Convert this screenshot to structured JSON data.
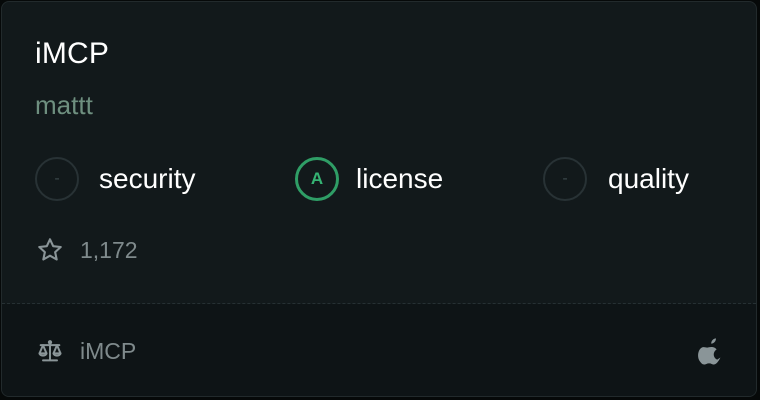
{
  "repo": {
    "name": "iMCP",
    "author": "mattt"
  },
  "metrics": {
    "security": {
      "grade": "-",
      "label": "security"
    },
    "license": {
      "grade": "A",
      "label": "license",
      "color": "#35b373"
    },
    "quality": {
      "grade": "-",
      "label": "quality"
    }
  },
  "stars": {
    "icon": "star-outline-icon",
    "count": "1,172"
  },
  "footer": {
    "license_icon": "scale-icon",
    "license_label": "iMCP",
    "platform_icon": "apple-icon"
  },
  "colors": {
    "card_background": "#12191b",
    "footer_background": "#0e1416",
    "author": "#6e8f7f",
    "accent_green": "#2f9e66",
    "muted_text": "#7f8a8c"
  }
}
